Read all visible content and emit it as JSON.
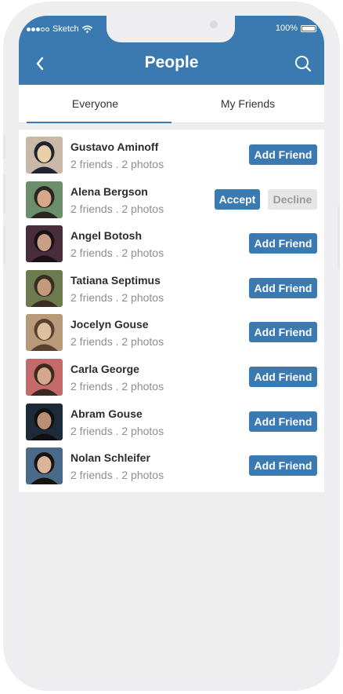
{
  "status_bar": {
    "carrier": "Sketch",
    "battery_text": "100%"
  },
  "header": {
    "title": "People",
    "back_icon": "chevron-left-icon",
    "search_icon": "search-icon",
    "background_color": "#3a7ab0"
  },
  "tabs": [
    {
      "label": "Everyone",
      "active": true
    },
    {
      "label": "My Friends",
      "active": false
    }
  ],
  "people": [
    {
      "name": "Gustavo Aminoff",
      "meta": "2 friends . 2 photos",
      "action": "add",
      "avatar_colors": [
        "#c9b8a6",
        "#1f2430",
        "#e8d0a8"
      ]
    },
    {
      "name": "Alena Bergson",
      "meta": "2 friends . 2 photos",
      "action": "request",
      "avatar_colors": [
        "#6b8f6a",
        "#2a2522",
        "#d6a889"
      ]
    },
    {
      "name": "Angel Botosh",
      "meta": "2 friends . 2 photos",
      "action": "add",
      "avatar_colors": [
        "#4a2d3c",
        "#1a1114",
        "#c99e86"
      ]
    },
    {
      "name": "Tatiana Septimus",
      "meta": "2 friends . 2 photos",
      "action": "add",
      "avatar_colors": [
        "#6e7a4f",
        "#3a2d22",
        "#c49a7c"
      ]
    },
    {
      "name": "Jocelyn Gouse",
      "meta": "2 friends . 2 photos",
      "action": "add",
      "avatar_colors": [
        "#b99a78",
        "#5a4030",
        "#dcc1a0"
      ]
    },
    {
      "name": "Carla George",
      "meta": "2 friends . 2 photos",
      "action": "add",
      "avatar_colors": [
        "#c46a6a",
        "#3b2a20",
        "#d3a88a"
      ]
    },
    {
      "name": "Abram Gouse",
      "meta": "2 friends . 2 photos",
      "action": "add",
      "avatar_colors": [
        "#1d2a3a",
        "#111111",
        "#b98e74"
      ]
    },
    {
      "name": "Nolan Schleifer",
      "meta": "2 friends . 2 photos",
      "action": "add",
      "avatar_colors": [
        "#4a6a8a",
        "#1a1410",
        "#d9b49a"
      ]
    }
  ],
  "labels": {
    "add_friend": "Add Friend",
    "accept": "Accept",
    "decline": "Decline"
  }
}
